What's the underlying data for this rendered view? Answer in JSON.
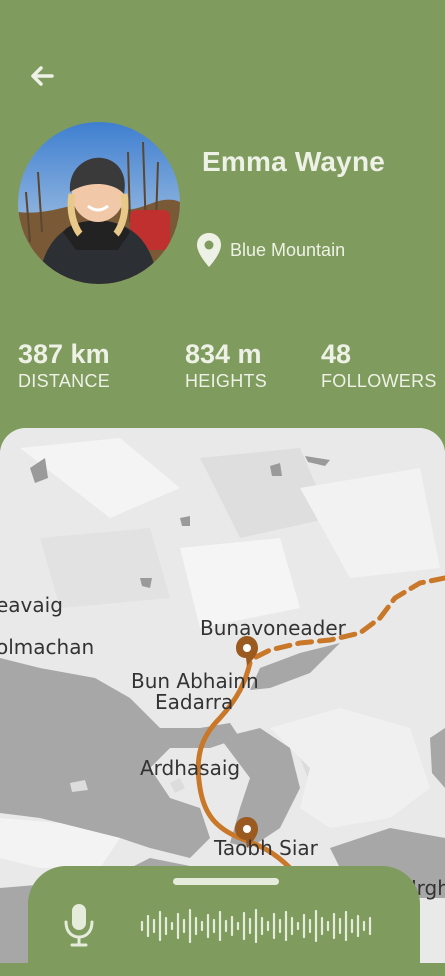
{
  "header": {
    "back_icon": "arrow-left-icon"
  },
  "profile": {
    "name": "Emma Wayne",
    "location_icon": "map-pin-icon",
    "location": "Blue Mountain"
  },
  "stats": [
    {
      "value": "387 km",
      "label": "DISTANCE"
    },
    {
      "value": "834 m",
      "label": "HEIGHTS"
    },
    {
      "value": "48",
      "label": "FOLLOWERS"
    }
  ],
  "map": {
    "places": [
      "eavaig",
      "olmachan",
      "Bunavoneader",
      "Bun Abhainn",
      "Eadarra",
      "Ardhasaig",
      "Taobh Siar",
      "Urgh"
    ],
    "route_color": "#c9782a"
  },
  "bottom_sheet": {
    "mic_icon": "microphone-icon",
    "waveform_icon": "audio-waveform-icon"
  }
}
